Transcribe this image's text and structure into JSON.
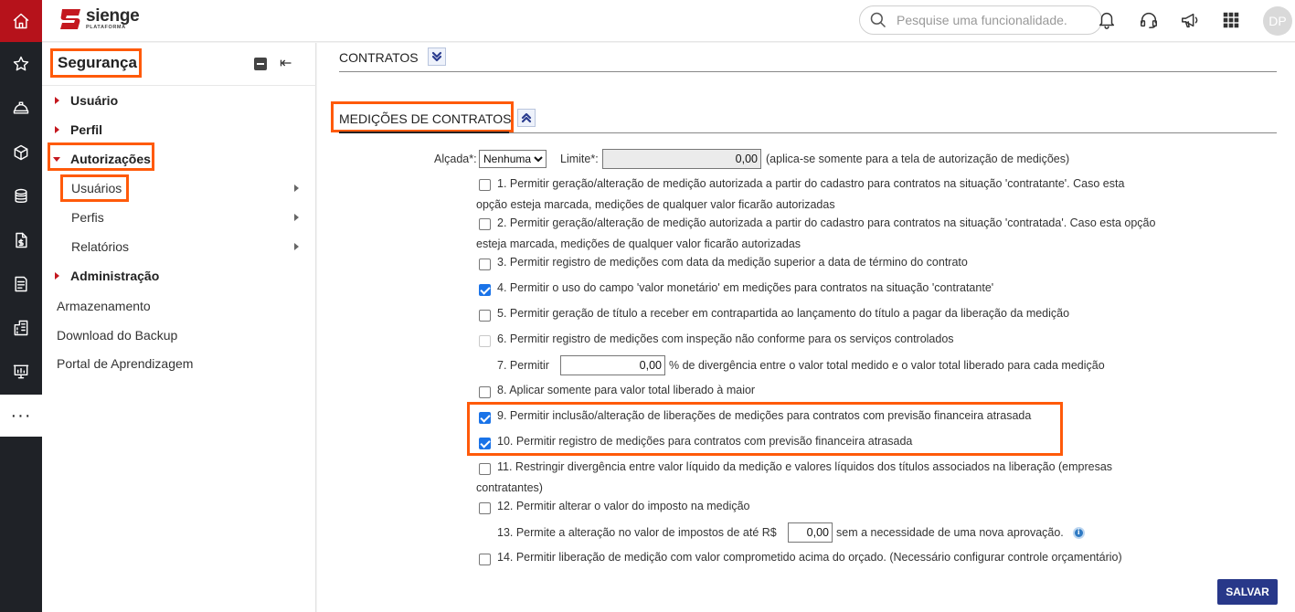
{
  "brand": {
    "name": "sienge",
    "tagline": "PLATAFORMA",
    "color": "#b6121b",
    "highlight": "#ff5a0a"
  },
  "rail": [
    "home-icon",
    "star-icon",
    "helmet-icon",
    "cube-icon",
    "coins-icon",
    "document-money-icon",
    "report-icon",
    "building-icon",
    "presentation-icon",
    "more-icon"
  ],
  "rail_more_label": "···",
  "search": {
    "placeholder": "Pesquise uma funcionalidade."
  },
  "user": {
    "initials": "DP"
  },
  "sidebar": {
    "title": "Segurança",
    "pin_glyph": "⇤",
    "items": [
      {
        "label": "Usuário"
      },
      {
        "label": "Perfil"
      },
      {
        "label": "Autorizações"
      },
      {
        "label": "Usuários"
      },
      {
        "label": "Perfis"
      },
      {
        "label": "Relatórios"
      },
      {
        "label": "Administração"
      },
      {
        "label": "Armazenamento"
      },
      {
        "label": "Download do Backup"
      },
      {
        "label": "Portal de Aprendizagem"
      }
    ]
  },
  "main": {
    "section_contratos": "CONTRATOS",
    "section_medicoes": "MEDIÇÕES DE CONTRATOS",
    "alcada_label": "Alçada*:",
    "alcada_value": "Nenhuma",
    "limite_label": "Limite*:",
    "limite_value": "0,00",
    "limite_note": "(aplica-se somente para a tela de autorização de medições)",
    "options": [
      {
        "text1": "1. Permitir geração/alteração de medição autorizada a partir do cadastro para contratos na situação 'contratante'. Caso esta",
        "text2": "opção esteja marcada, medições de qualquer valor ficarão autorizadas",
        "checked": false
      },
      {
        "text1": "2. Permitir geração/alteração de medição autorizada a partir do cadastro para contratos na situação 'contratada'. Caso esta opção",
        "text2": "esteja marcada, medições de qualquer valor ficarão autorizadas",
        "checked": false
      },
      {
        "text1": "3. Permitir registro de medições com data da medição superior a data de término do contrato",
        "checked": false
      },
      {
        "text1": "4. Permitir o uso do campo 'valor monetário' em medições para contratos na situação 'contratante'",
        "checked": true
      },
      {
        "text1": "5. Permitir geração de título a receber em contrapartida ao lançamento do título a pagar da liberação da medição",
        "checked": false
      },
      {
        "text1": "6. Permitir registro de medições com inspeção não conforme para os serviços controlados",
        "checked": false,
        "disabled": true
      },
      {
        "pre": "7. Permitir",
        "value": "0,00",
        "post": "% de divergência entre o valor total medido e o valor total liberado para cada medição"
      },
      {
        "text1": "8. Aplicar somente para valor total liberado à maior",
        "checked": false
      },
      {
        "text1": "9. Permitir inclusão/alteração de liberações de medições para contratos com previsão financeira atrasada",
        "checked": true
      },
      {
        "text1": "10. Permitir registro de medições para contratos com previsão financeira atrasada",
        "checked": true
      },
      {
        "text1": "11. Restringir divergência entre valor líquido da medição e valores líquidos dos títulos associados na liberação (empresas",
        "text2": "contratantes)",
        "checked": false
      },
      {
        "text1": "12. Permitir alterar o valor do imposto na medição",
        "checked": false
      },
      {
        "pre": "13. Permite a alteração no valor de impostos de até R$",
        "value": "0,00",
        "post": "sem a necessidade de uma nova aprovação."
      },
      {
        "text1": "14. Permitir liberação de medição com valor comprometido acima do orçado. (Necessário configurar controle orçamentário)",
        "checked": false
      }
    ],
    "save_label": "SALVAR"
  }
}
